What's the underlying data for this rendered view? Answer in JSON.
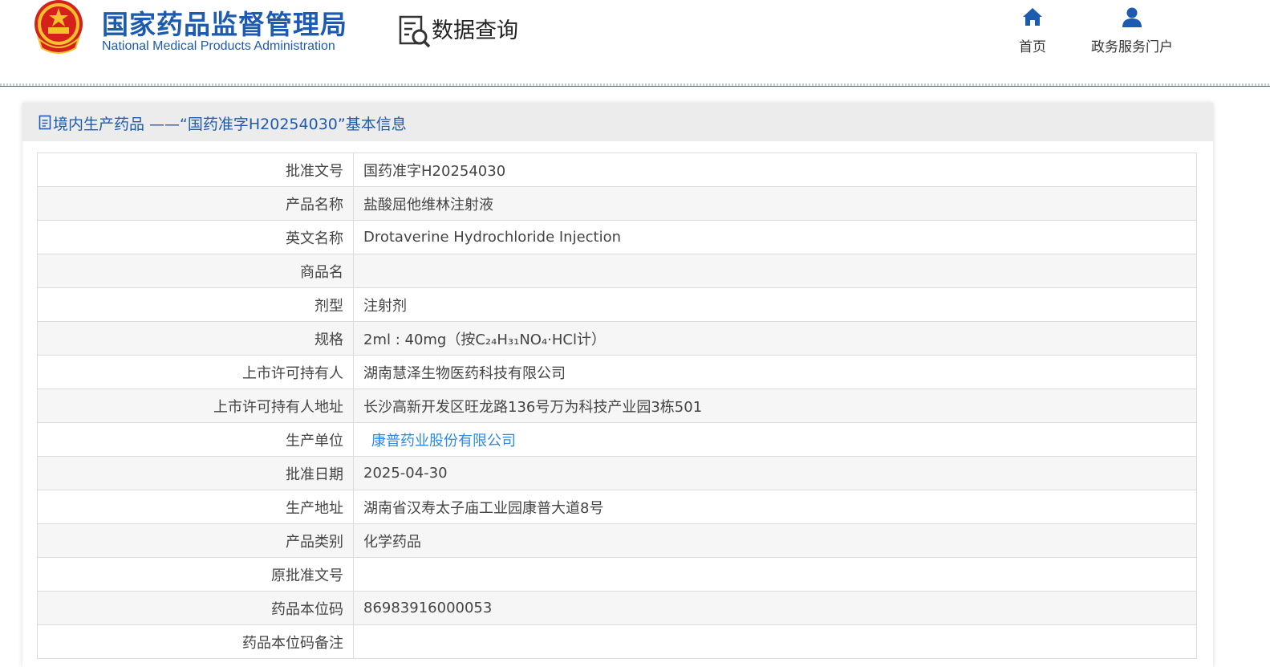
{
  "header": {
    "site_title": "国家药品监督管理局",
    "site_subtitle": "National Medical Products Administration",
    "query_title": "数据查询",
    "nav": [
      {
        "label": "首页",
        "icon": "home-icon"
      },
      {
        "label": "政务服务门户",
        "icon": "user-icon"
      }
    ]
  },
  "panel": {
    "title": "境内生产药品 ——“国药准字H20254030”基本信息",
    "icon": "document-icon"
  },
  "rows": [
    {
      "label": "批准文号",
      "value": "国药准字H20254030"
    },
    {
      "label": "产品名称",
      "value": "盐酸屈他维林注射液"
    },
    {
      "label": "英文名称",
      "value": "Drotaverine Hydrochloride Injection"
    },
    {
      "label": "商品名",
      "value": ""
    },
    {
      "label": "剂型",
      "value": "注射剂"
    },
    {
      "label": "规格",
      "value": "2ml : 40mg（按C₂₄H₃₁NO₄·HCl计）"
    },
    {
      "label": "上市许可持有人",
      "value": "湖南慧泽生物医药科技有限公司"
    },
    {
      "label": "上市许可持有人地址",
      "value": "长沙高新开发区旺龙路136号万为科技产业园3栋501"
    },
    {
      "label": "生产单位",
      "value": "康普药业股份有限公司",
      "link": true
    },
    {
      "label": "批准日期",
      "value": "2025-04-30"
    },
    {
      "label": "生产地址",
      "value": "湖南省汉寿太子庙工业园康普大道8号"
    },
    {
      "label": "产品类别",
      "value": "化学药品"
    },
    {
      "label": "原批准文号",
      "value": ""
    },
    {
      "label": "药品本位码",
      "value": "86983916000053"
    },
    {
      "label": "药品本位码备注",
      "value": ""
    }
  ],
  "colors": {
    "brand": "#1d5bb0",
    "link": "#2b8ae6"
  }
}
